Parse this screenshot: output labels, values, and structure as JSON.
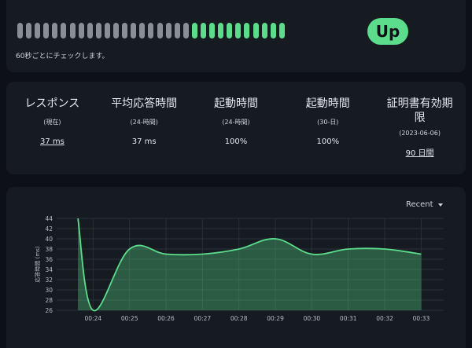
{
  "heartbeat": {
    "beats": [
      "down",
      "down",
      "down",
      "down",
      "down",
      "down",
      "down",
      "down",
      "down",
      "down",
      "down",
      "down",
      "down",
      "down",
      "down",
      "down",
      "down",
      "down",
      "down",
      "down",
      "up",
      "up",
      "up",
      "up",
      "up",
      "up",
      "up",
      "up",
      "up",
      "up",
      "up"
    ],
    "status_label": "Up",
    "check_note": "60秒ごとにチェックします。"
  },
  "stats": [
    {
      "title": "レスポンス",
      "sub": "(現在)",
      "value": "37 ms",
      "link": true
    },
    {
      "title": "平均応答時間",
      "sub": "(24-時間)",
      "value": "37 ms",
      "link": false
    },
    {
      "title": "起動時間",
      "sub": "(24-時間)",
      "value": "100%",
      "link": false
    },
    {
      "title": "起動時間",
      "sub": "(30-日)",
      "value": "100%",
      "link": false
    },
    {
      "title": "証明書有効期限",
      "sub": "(2023-06-06)",
      "value": "90 日間",
      "link": true
    }
  ],
  "period": {
    "selected": "Recent"
  },
  "colors": {
    "accent": "#5cdd8b",
    "down": "#8a8f96",
    "card": "#161b22",
    "bg": "#0d1117"
  },
  "chart_data": {
    "type": "area",
    "ylabel": "応答時間 (ms)",
    "ylim": [
      26,
      44
    ],
    "yticks": [
      26,
      28,
      30,
      32,
      34,
      36,
      38,
      40,
      42,
      44
    ],
    "xticks": [
      "00:24",
      "00:25",
      "00:26",
      "00:27",
      "00:28",
      "00:29",
      "00:30",
      "00:31",
      "00:32",
      "00:33"
    ],
    "x": [
      "00:23:35",
      "00:24:00",
      "00:25:00",
      "00:26:00",
      "00:27:00",
      "00:28:00",
      "00:29:00",
      "00:30:00",
      "00:31:00",
      "00:32:00",
      "00:33:00"
    ],
    "series": [
      {
        "values": [
          44,
          26,
          38,
          37,
          37,
          38,
          40,
          37,
          38,
          38,
          37
        ]
      }
    ]
  }
}
